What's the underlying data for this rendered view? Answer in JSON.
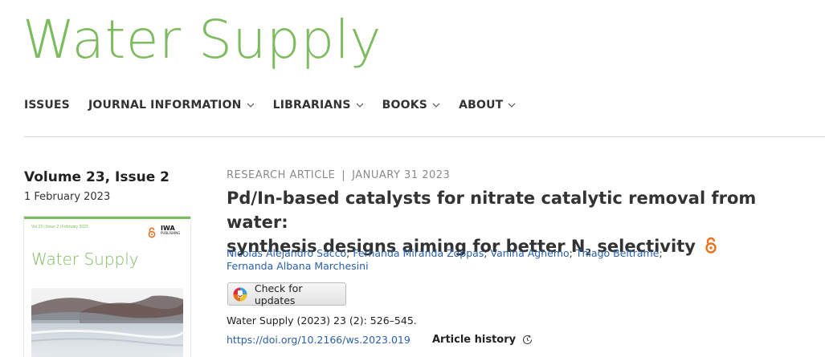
{
  "journal": {
    "title": "Water Supply"
  },
  "nav": {
    "items": [
      {
        "label": "ISSUES",
        "has_menu": false
      },
      {
        "label": "JOURNAL INFORMATION",
        "has_menu": true
      },
      {
        "label": "LIBRARIANS",
        "has_menu": true
      },
      {
        "label": "BOOKS",
        "has_menu": true
      },
      {
        "label": "ABOUT",
        "has_menu": true
      }
    ]
  },
  "issue": {
    "title": "Volume 23, Issue 2",
    "date": "1 February 2023",
    "cover": {
      "meta": "Vol 23 | Issue 2 | February 2023",
      "title": "Water Supply",
      "logo_text": "IWA",
      "logo_subtext": "PUBLISHING"
    }
  },
  "article": {
    "type": "RESEARCH ARTICLE",
    "separator": "|",
    "date": "JANUARY 31 2023",
    "title_line1": "Pd/In-based catalysts for nitrate catalytic removal from water:",
    "title_line2_pre": "synthesis designs aiming for better N",
    "title_sub": "2",
    "title_line2_post": " selectivity",
    "authors": [
      "Nicolas Alejandro Sacco",
      "Fernanda Miranda Zoppas",
      "Vanina Aghemo",
      "Thiago Beltrame",
      "Fernanda Albana Marchesini"
    ],
    "author_separator": ";",
    "check_updates_label": "Check for updates",
    "citation": "Water Supply (2023) 23 (2): 526–545.",
    "doi": "https://doi.org/10.2166/ws.2023.019",
    "history_label": "Article history"
  },
  "colors": {
    "brand_green": "#7dbb5f",
    "link_blue": "#2a5fa8",
    "open_access_orange": "#e8711a"
  },
  "icons": {
    "nav_chevron": "chevron-down-icon",
    "open_access": "open-access-icon",
    "check_updates": "crossmark-icon",
    "history": "clock-icon"
  }
}
